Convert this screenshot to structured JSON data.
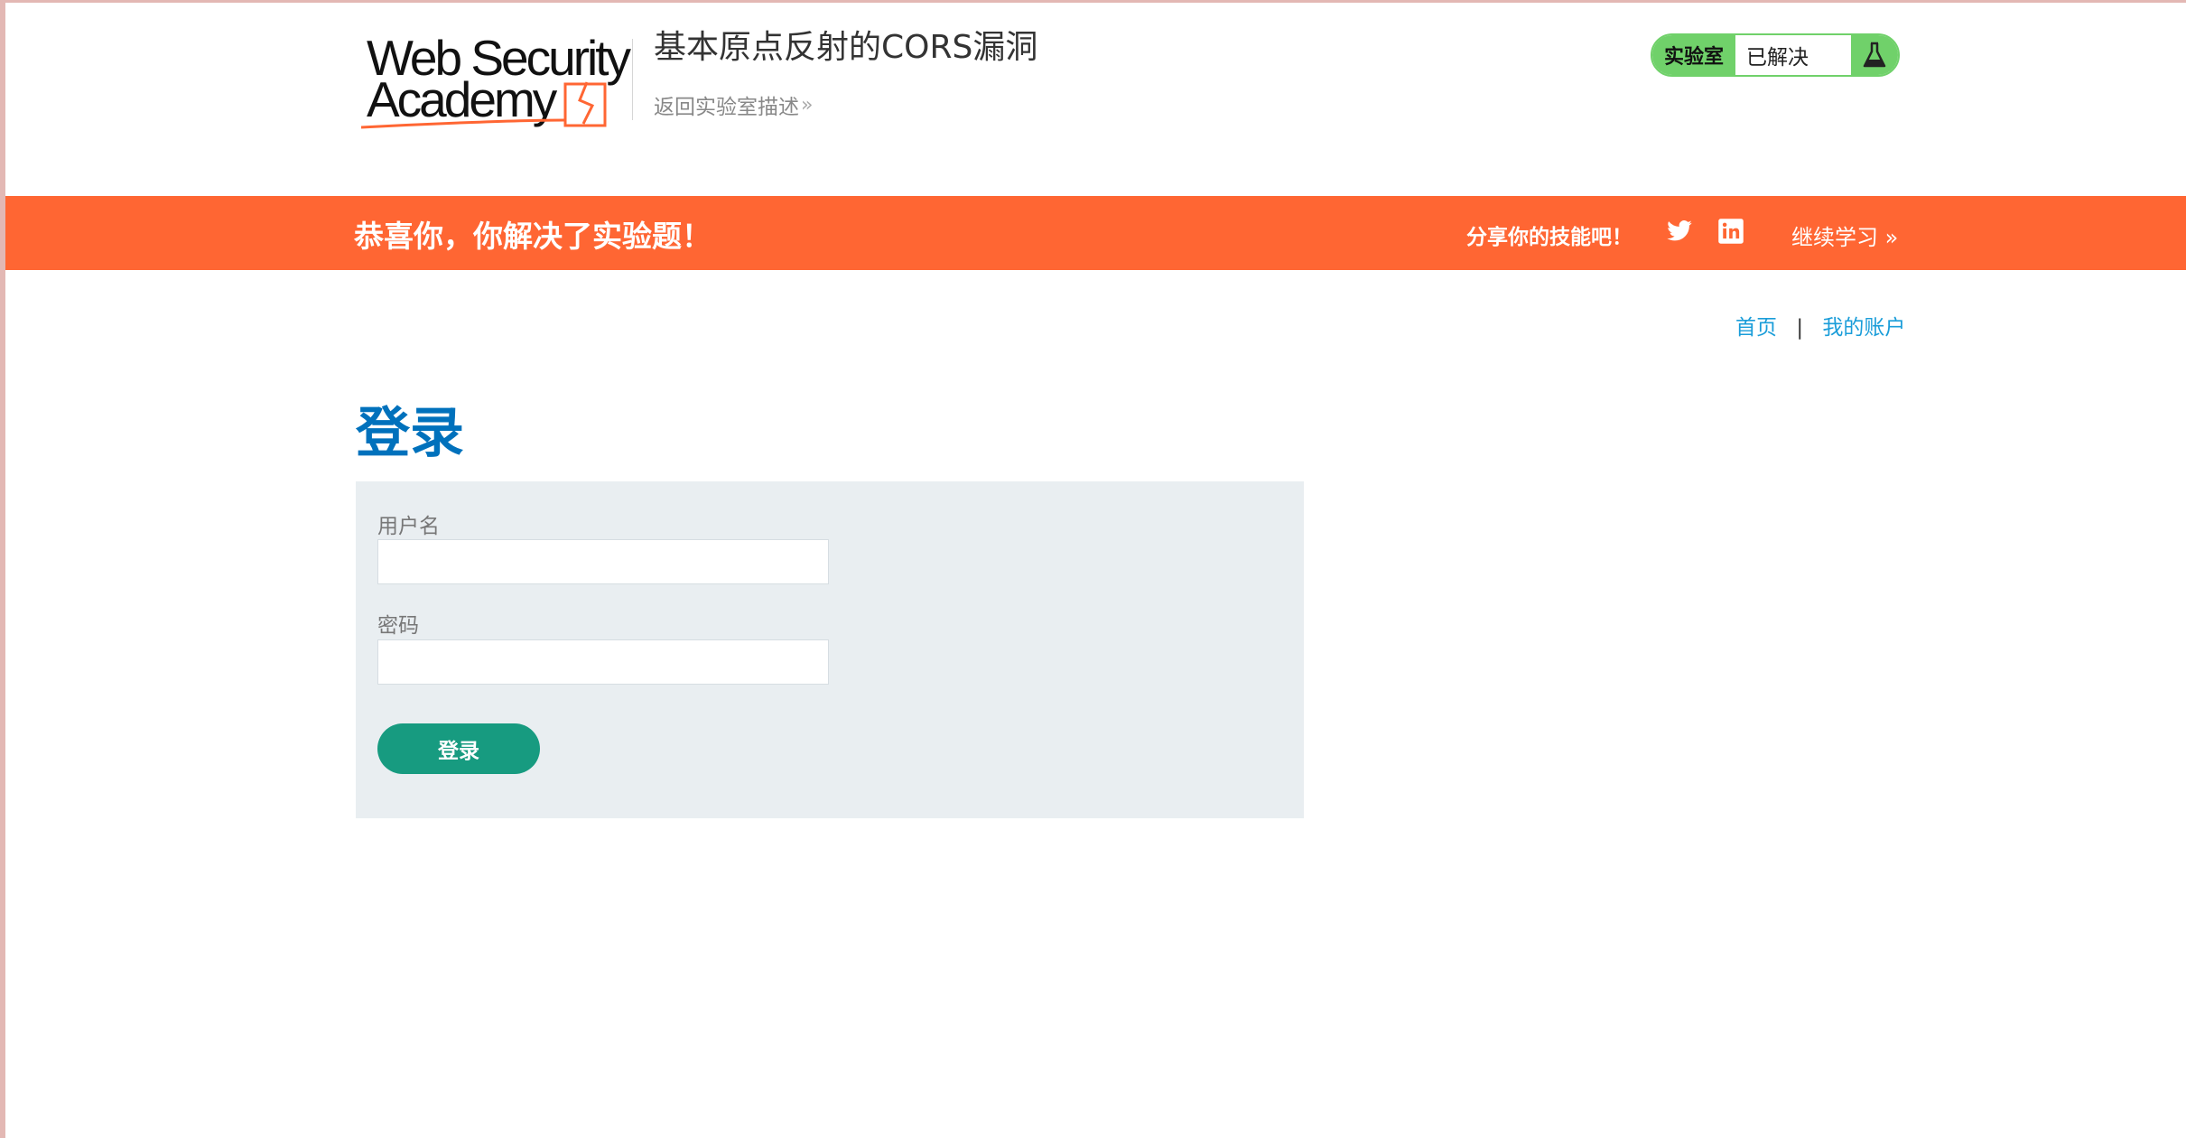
{
  "header": {
    "logo_line1": "Web Security",
    "logo_line2": "Academy",
    "lab_title": "基本原点反射的CORS漏洞",
    "back_link": "返回实验室描述",
    "status_label": "实验室",
    "status_value": "已解决",
    "status_color": "#70d16a"
  },
  "banner": {
    "message": "恭喜你，你解决了实验题！",
    "share_label": "分享你的技能吧！",
    "continue_label": "继续学习",
    "color": "#ff6633"
  },
  "nav": {
    "home": "首页",
    "separator": "|",
    "account": "我的账户"
  },
  "main": {
    "title": "登录",
    "username_label": "用户名",
    "username_value": "",
    "password_label": "密码",
    "password_value": "",
    "submit_label": "登录"
  },
  "icons": [
    "twitter-icon",
    "linkedin-icon",
    "flask-icon",
    "chevron-right-icon"
  ]
}
